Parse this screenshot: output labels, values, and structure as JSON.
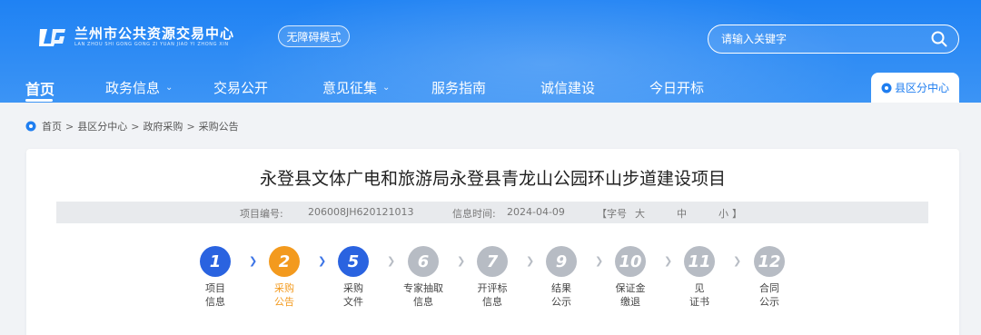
{
  "header": {
    "logo_title": "兰州市公共资源交易中心",
    "logo_sub": "LAN ZHOU SHI GONG GONG ZI YUAN JIAO YI ZHONG XIN",
    "accessibility_label": "无障碍模式",
    "search_placeholder": "请输入关键字"
  },
  "nav": {
    "items": [
      {
        "label": "首页"
      },
      {
        "label": "政务信息"
      },
      {
        "label": "交易公开"
      },
      {
        "label": "意见征集"
      },
      {
        "label": "服务指南"
      },
      {
        "label": "诚信建设"
      },
      {
        "label": "今日开标"
      }
    ],
    "county_tab": "县区分中心"
  },
  "breadcrumb": {
    "items": [
      "首页",
      "县区分中心",
      "政府采购",
      "采购公告"
    ]
  },
  "article": {
    "title": "永登县文体广电和旅游局永登县青龙山公园环山步道建设项目",
    "project_no_label": "项目编号:",
    "project_no": "206008JH620121013",
    "time_label": "信息时间:",
    "time": "2024-04-09",
    "font_size_label": "【字号",
    "font_large": "大",
    "font_medium": "中",
    "font_small": "小",
    "font_close": "】"
  },
  "steps": [
    {
      "num": "1",
      "label": "项目\n信息",
      "state": "done"
    },
    {
      "num": "2",
      "label": "采购\n公告",
      "state": "current"
    },
    {
      "num": "5",
      "label": "采购\n文件",
      "state": "done"
    },
    {
      "num": "6",
      "label": "专家抽取\n信息",
      "state": "pending"
    },
    {
      "num": "7",
      "label": "开评标\n信息",
      "state": "pending"
    },
    {
      "num": "9",
      "label": "结果\n公示",
      "state": "pending"
    },
    {
      "num": "10",
      "label": "保证金\n缴退",
      "state": "pending"
    },
    {
      "num": "11",
      "label": "见\n证书",
      "state": "pending"
    },
    {
      "num": "12",
      "label": "合同\n公示",
      "state": "pending"
    }
  ],
  "colors": {
    "done": "#2a63e0",
    "current": "#f39a1e",
    "pending": "#b7bcc4",
    "arrow_active": "#3c74e6",
    "arrow_pending": "#b7bcc4"
  }
}
